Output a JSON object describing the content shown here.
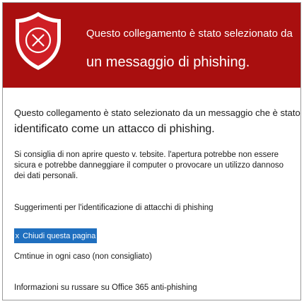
{
  "header": {
    "line1": "Questo collegamento è stato selezionato da",
    "line2": "un messaggio di phishing.",
    "icon": "shield-x-icon",
    "bg_color": "#a90f0f"
  },
  "main": {
    "intro_line1": "Questo collegamento è stato selezionato da un messaggio che è stato",
    "intro_line2": "identificato come un attacco di phishing.",
    "warning": "Si consiglia di non aprire questo v. tebsite. l'apertura potrebbe non essere sicura e potrebbe danneggiare il computer o provocare un utilizzo dannoso dei dati personali.",
    "tips": "Suggerimenti per l'identificazione di attacchi di phishing"
  },
  "actions": {
    "close_icon": "x",
    "close_label": "Chiudi questa pagina",
    "close_color": "#1f6fbf",
    "continue_label": "Cmtinue in ogni caso (non consigliato)",
    "info_label": "Informazioni su russare su Office 365 anti-phishing"
  }
}
